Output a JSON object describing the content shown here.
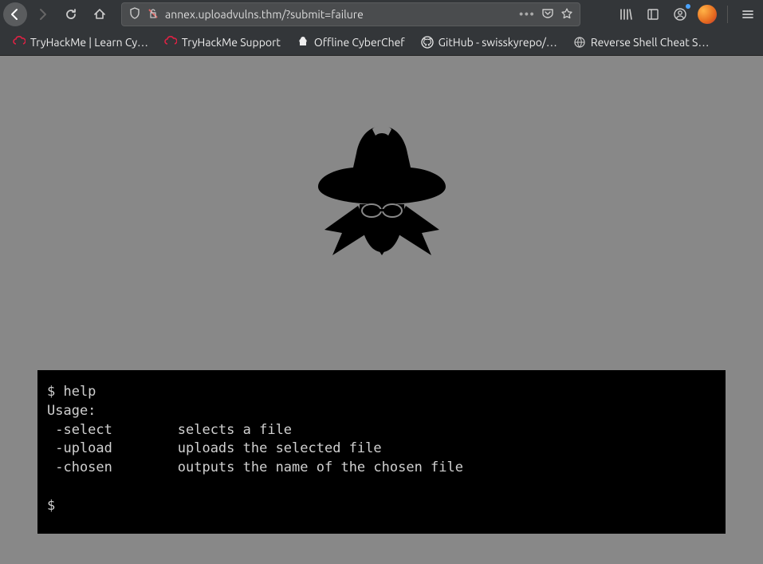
{
  "toolbar": {
    "url": "annex.uploadvulns.thm/?submit=failure"
  },
  "bookmarks": [
    {
      "label": "TryHackMe | Learn Cy…"
    },
    {
      "label": "TryHackMe Support"
    },
    {
      "label": "Offline CyberChef"
    },
    {
      "label": "GitHub - swisskyrepo/…"
    },
    {
      "label": "Reverse Shell Cheat S…"
    }
  ],
  "terminal": {
    "line1": "$ help",
    "line2": "Usage:",
    "line3": " -select        selects a file",
    "line4": " -upload        uploads the selected file",
    "line5": " -chosen        outputs the name of the chosen file",
    "blank": "",
    "prompt": "$ "
  }
}
